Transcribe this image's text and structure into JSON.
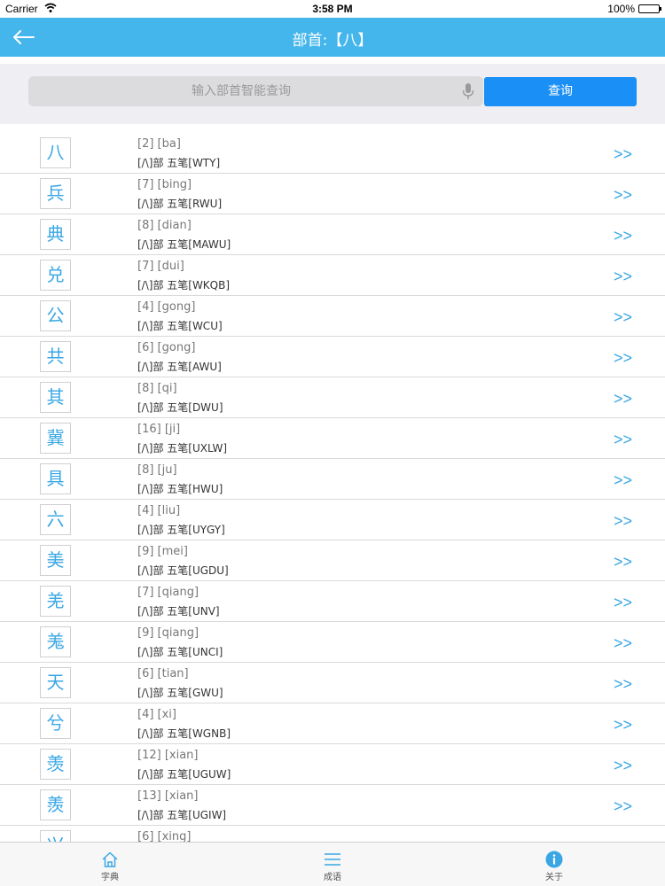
{
  "status_bar": {
    "carrier": "Carrier",
    "time": "3:58 PM",
    "battery": "100%"
  },
  "nav": {
    "title": "部首:【八】"
  },
  "search": {
    "placeholder": "输入部首智能查询",
    "button_label": "查询"
  },
  "list": {
    "arrow": ">>",
    "items": [
      {
        "char": "八",
        "info": "[2] [ba]",
        "detail": "[/\\]部 五笔[WTY]"
      },
      {
        "char": "兵",
        "info": "[7] [bing]",
        "detail": "[/\\]部 五笔[RWU]"
      },
      {
        "char": "典",
        "info": "[8] [dian]",
        "detail": "[/\\]部 五笔[MAWU]"
      },
      {
        "char": "兑",
        "info": "[7] [dui]",
        "detail": "[/\\]部 五笔[WKQB]"
      },
      {
        "char": "公",
        "info": "[4] [gong]",
        "detail": "[/\\]部 五笔[WCU]"
      },
      {
        "char": "共",
        "info": "[6] [gong]",
        "detail": "[/\\]部 五笔[AWU]"
      },
      {
        "char": "其",
        "info": "[8] [qi]",
        "detail": "[/\\]部 五笔[DWU]"
      },
      {
        "char": "冀",
        "info": "[16] [ji]",
        "detail": "[/\\]部 五笔[UXLW]"
      },
      {
        "char": "具",
        "info": "[8] [ju]",
        "detail": "[/\\]部 五笔[HWU]"
      },
      {
        "char": "六",
        "info": "[4] [liu]",
        "detail": "[/\\]部 五笔[UYGY]"
      },
      {
        "char": "美",
        "info": "[9] [mei]",
        "detail": "[/\\]部 五笔[UGDU]"
      },
      {
        "char": "羌",
        "info": "[7] [qiang]",
        "detail": "[/\\]部 五笔[UNV]"
      },
      {
        "char": "羗",
        "info": "[9] [qiang]",
        "detail": "[/\\]部 五笔[UNCI]"
      },
      {
        "char": "天",
        "info": "[6] [tian]",
        "detail": "[/\\]部 五笔[GWU]"
      },
      {
        "char": "兮",
        "info": "[4] [xi]",
        "detail": "[/\\]部 五笔[WGNB]"
      },
      {
        "char": "羡",
        "info": "[12] [xian]",
        "detail": "[/\\]部 五笔[UGUW]"
      },
      {
        "char": "羨",
        "info": "[13] [xian]",
        "detail": "[/\\]部 五笔[UGIW]"
      },
      {
        "char": "兴",
        "info": "[6] [xing]",
        "detail": ""
      }
    ]
  },
  "tabs": [
    {
      "label": "字典",
      "icon": "house-icon"
    },
    {
      "label": "成语",
      "icon": "list-icon"
    },
    {
      "label": "关于",
      "icon": "info-icon"
    }
  ],
  "colors": {
    "accent": "#45b6ec",
    "button": "#1a8ff5",
    "char": "#3aa7e4"
  }
}
